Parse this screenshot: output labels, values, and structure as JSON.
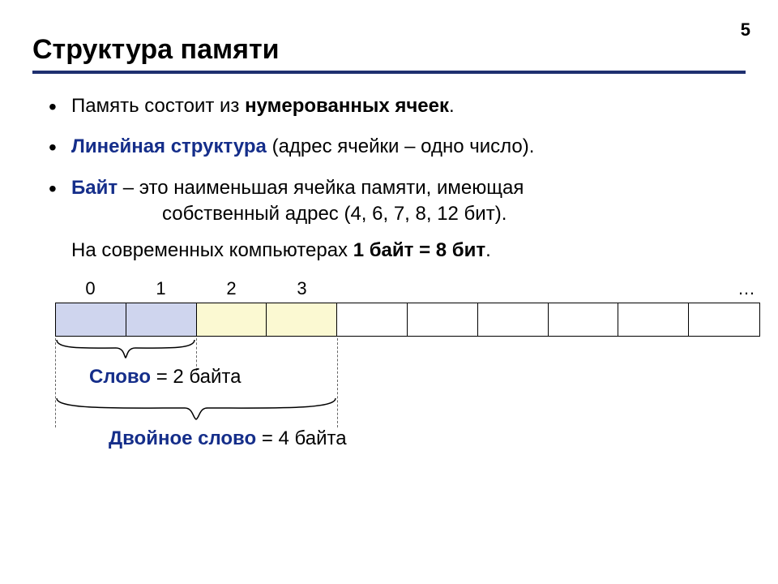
{
  "page_number": "5",
  "title": "Структура памяти",
  "bullets": {
    "b1_pre": "Память состоит из ",
    "b1_bold": "нумерованных ячеек",
    "b1_post": ".",
    "b2_term": "Линейная структура",
    "b2_rest": " (адрес ячейки – одно число).",
    "b3_term": "Байт",
    "b3_line1": " – это наименьшая ячейка памяти, имеющая",
    "b3_line2": "собственный адрес (4, 6, 7, 8, 12 бит)."
  },
  "subline_pre": "На современных компьютерах ",
  "subline_bold": "1 байт = 8 бит",
  "subline_post": ".",
  "indices": [
    "0",
    "1",
    "2",
    "3"
  ],
  "dots": "…",
  "word_term": "Слово",
  "word_rest": " = 2 байта",
  "dword_term": "Двойное слово",
  "dword_rest": " = 4 байта"
}
